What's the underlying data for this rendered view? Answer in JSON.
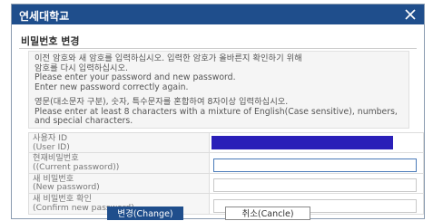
{
  "window": {
    "title": "연세대학교"
  },
  "section": {
    "title": "비밀번호 변경"
  },
  "notice": {
    "para1": "이전 암호와 새 암호를 입력하십시오. 입력한 암호가 올바른지 확인하기 위해\n암호를 다시 입력하십시오.\nPlease enter your password and new password.\nEnter new password correctly again.",
    "para2": "영문(대소문자 구분), 숫자, 특수문자를 혼합하여 8자이상 입력하십시오.\nPlease enter at least 8 characters with a mixture of English(Case sensitive), numbers, and special characters."
  },
  "form": {
    "user_id_label": "사용자 ID\n(User ID)",
    "current_label": "현재비밀번호\n((Current password))",
    "new_label": "새 비밀번호\n(New password)",
    "confirm_label": "새 비밀번호 확인\n(Confirm new password)"
  },
  "buttons": {
    "change": "변경(Change)",
    "cancel": "취소(Cancle)"
  },
  "colors": {
    "titlebar": "#1f4e8c",
    "user_id_redaction": "#2a1fb8"
  }
}
